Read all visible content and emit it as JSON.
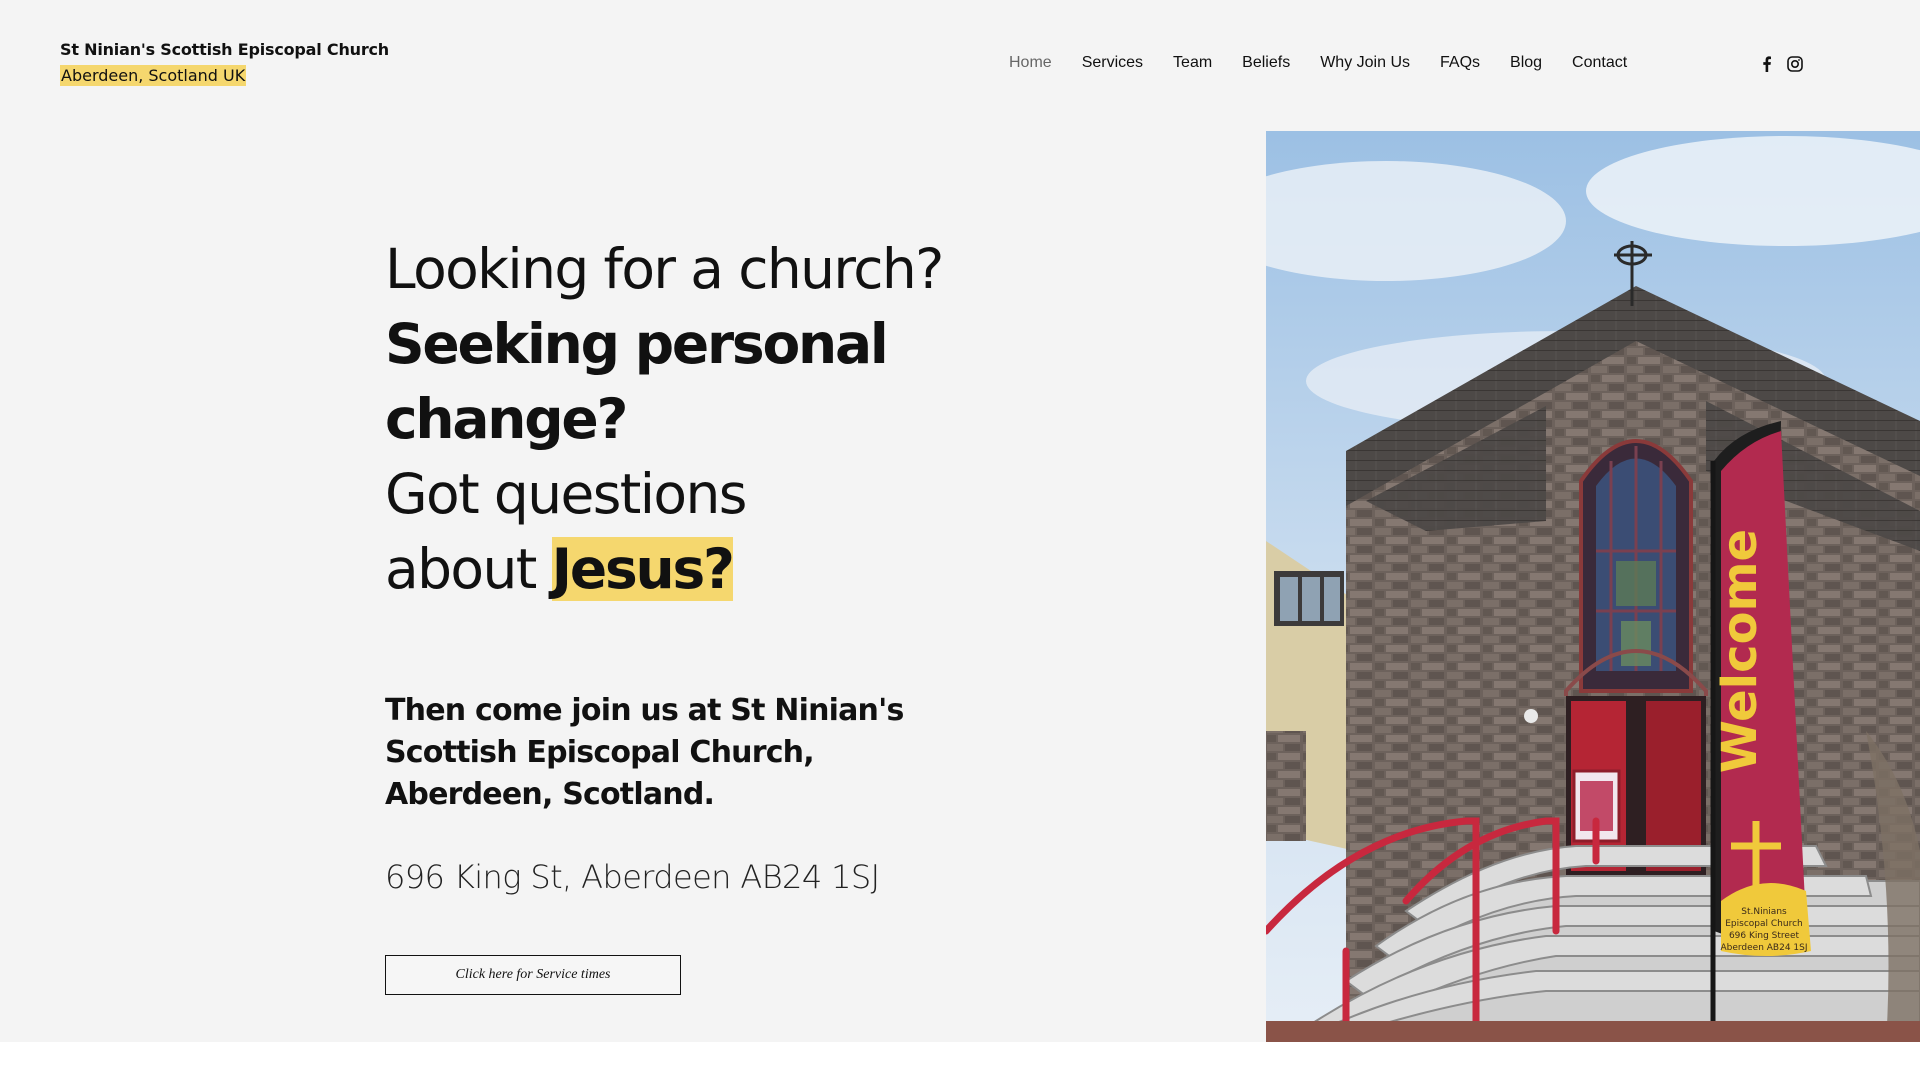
{
  "header": {
    "brand_name": "St Ninian's Scottish Episcopal Church",
    "brand_location": "Aberdeen, Scotland UK",
    "nav": [
      "Home",
      "Services",
      "Team",
      "Beliefs",
      "Why Join Us",
      "FAQs",
      "Blog",
      "Contact"
    ],
    "active_nav": "Home",
    "social_icons": [
      "facebook-icon",
      "instagram-icon"
    ]
  },
  "hero": {
    "line1": "Looking for a church?",
    "line2": "Seeking personal",
    "line3": "change?",
    "line4": "Got questions",
    "line5_prefix": "about",
    "line5_highlight": "Jesus?",
    "subheading": "Then come join us at St Ninian's Scottish Episcopal Church, Aberdeen, Scotland.",
    "address": "696 King St, Aberdeen AB24 1SJ",
    "cta_label": "Click here for Service times"
  },
  "photo": {
    "banner_text": "Welcome",
    "banner_footer": [
      "St.Ninians",
      "Episcopal Church",
      "696 King Street",
      "Aberdeen AB24 1SJ"
    ]
  },
  "colors": {
    "highlight": "#f5d76e",
    "background": "#f4f4f4",
    "banner": "#b22a4f",
    "railing": "#c8283e"
  }
}
